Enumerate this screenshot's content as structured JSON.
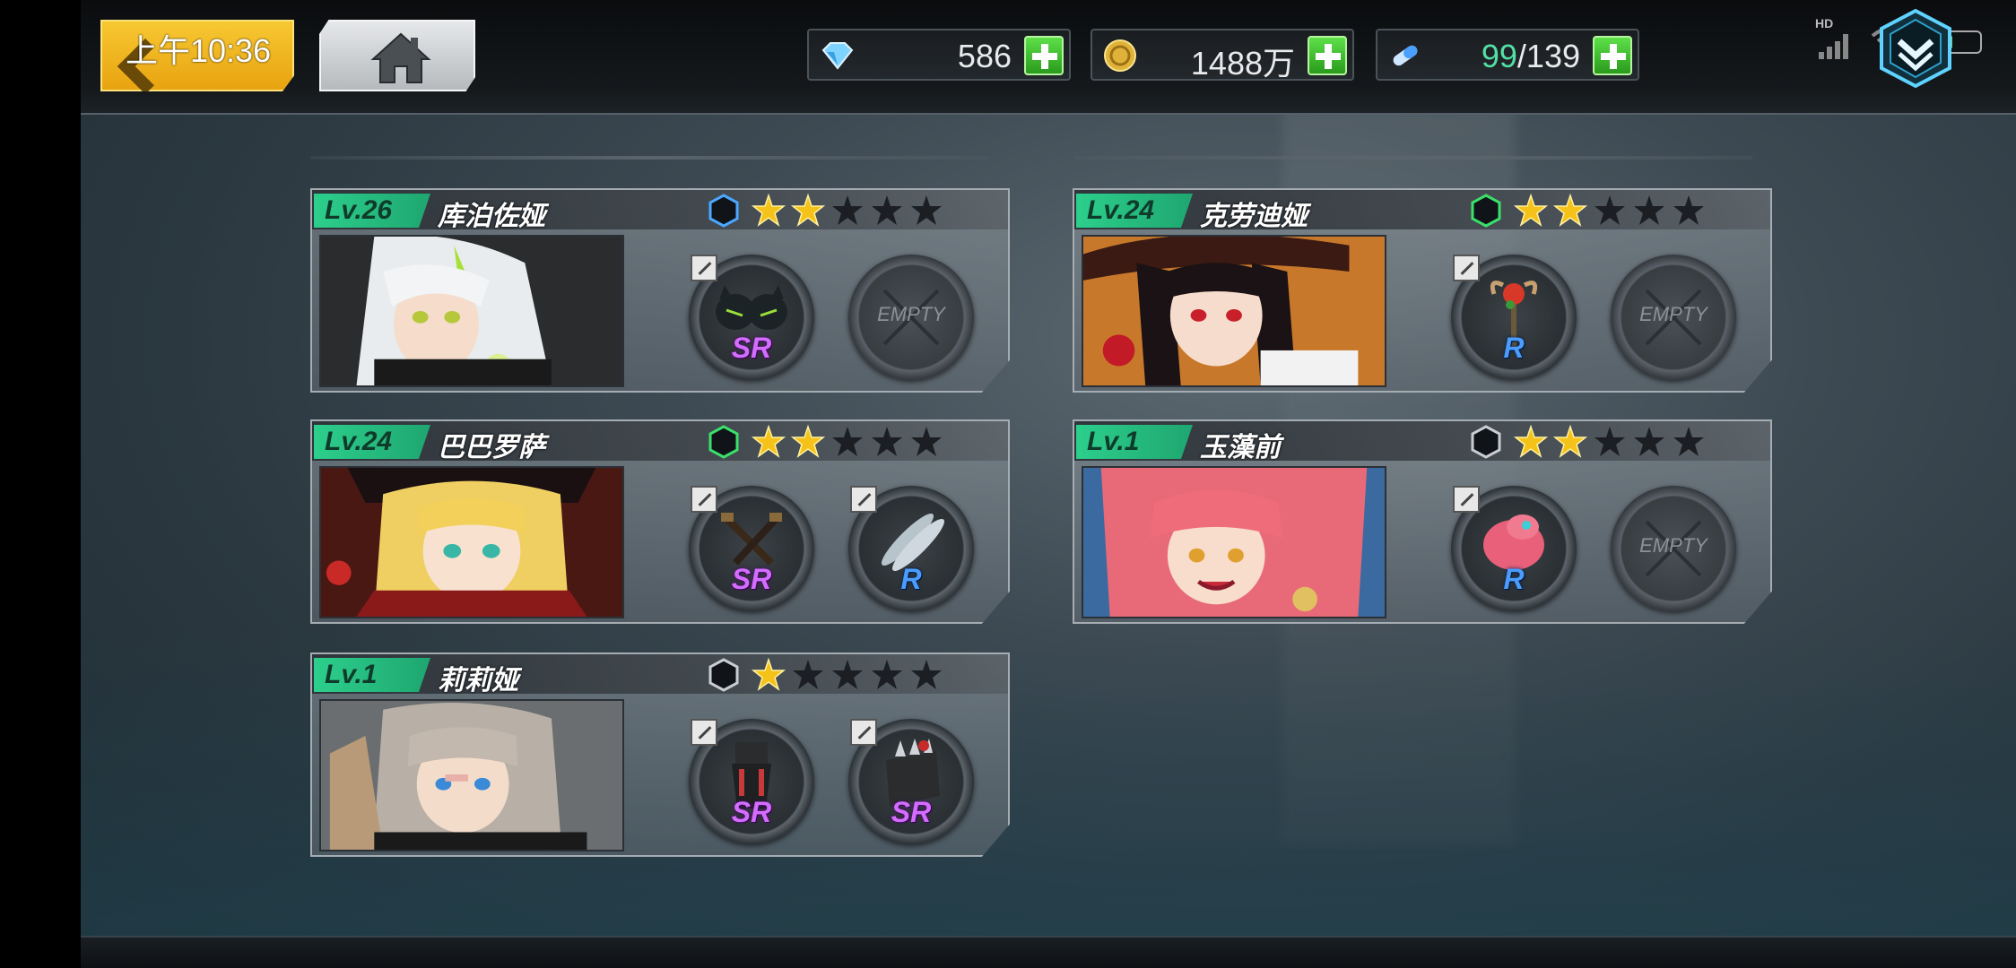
{
  "topbar": {
    "time": "上午10:36",
    "resources": [
      {
        "icon": "crystal-icon",
        "value": "586"
      },
      {
        "icon": "gold-coin-icon",
        "value": "1488万"
      },
      {
        "icon": "stamina-icon",
        "value_current": "99",
        "value_sep": "/",
        "value_max": "139"
      }
    ],
    "status": {
      "hd": "HD"
    }
  },
  "cards": [
    {
      "level": "Lv.26",
      "name": "库泊佐娅",
      "rarity_color": "#4aa8ff",
      "stars": 2,
      "portrait": "white-hair-girl",
      "slots": [
        {
          "item": "cat-goggles",
          "grade": "SR"
        },
        {
          "empty": true,
          "label": "EMPTY"
        }
      ]
    },
    {
      "level": "Lv.24",
      "name": "克劳迪娅",
      "rarity_color": "#3be06a",
      "stars": 2,
      "portrait": "witch-girl",
      "slots": [
        {
          "item": "rose-staff",
          "grade": "R"
        },
        {
          "empty": true,
          "label": "EMPTY"
        }
      ]
    },
    {
      "level": "Lv.24",
      "name": "巴巴罗萨",
      "rarity_color": "#3be06a",
      "stars": 2,
      "portrait": "pirate-blonde",
      "slots": [
        {
          "item": "flintlock-pistols",
          "grade": "SR"
        },
        {
          "item": "fish",
          "grade": "R"
        }
      ]
    },
    {
      "level": "Lv.1",
      "name": "玉藻前",
      "rarity_color": "#1a1d20",
      "stars": 2,
      "portrait": "pink-fox-girl",
      "slots": [
        {
          "item": "pink-plush",
          "grade": "R"
        },
        {
          "empty": true,
          "label": "EMPTY"
        }
      ]
    },
    {
      "level": "Lv.1",
      "name": "莉莉娅",
      "rarity_color": "#1a1d20",
      "stars": 1,
      "portrait": "grey-hair-girl",
      "slots": [
        {
          "item": "armor-gauntlet",
          "grade": "SR"
        },
        {
          "item": "spiked-glove",
          "grade": "SR"
        }
      ]
    }
  ],
  "colors": {
    "accent_green": "#2ccf8c",
    "star_gold": "#f5c21a",
    "sr": "#d36cff",
    "r": "#4a9cff"
  }
}
